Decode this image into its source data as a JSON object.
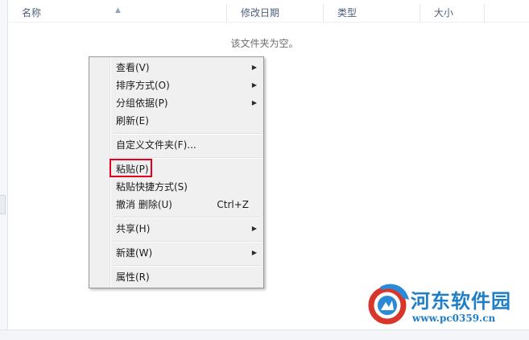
{
  "columns": {
    "name": "名称",
    "modified": "修改日期",
    "type": "类型",
    "size": "大小"
  },
  "empty_message": "该文件夹为空。",
  "context_menu": {
    "items": [
      {
        "label": "查看(V)",
        "submenu": true
      },
      {
        "label": "排序方式(O)",
        "submenu": true
      },
      {
        "label": "分组依据(P)",
        "submenu": true
      },
      {
        "label": "刷新(E)"
      },
      {
        "label": "自定义文件夹(F)..."
      },
      {
        "label": "粘贴(P)",
        "highlighted": true
      },
      {
        "label": "粘贴快捷方式(S)"
      },
      {
        "label": "撤消 删除(U)",
        "shortcut": "Ctrl+Z"
      },
      {
        "label": "共享(H)",
        "submenu": true
      },
      {
        "label": "新建(W)",
        "submenu": true
      },
      {
        "label": "属性(R)"
      }
    ]
  },
  "watermark": {
    "title": "河东软件园",
    "url": "www.pc0359.cn"
  },
  "colors": {
    "highlight_border": "#e6001e",
    "watermark": "#1f7ec8",
    "header_text": "#4c607a"
  }
}
